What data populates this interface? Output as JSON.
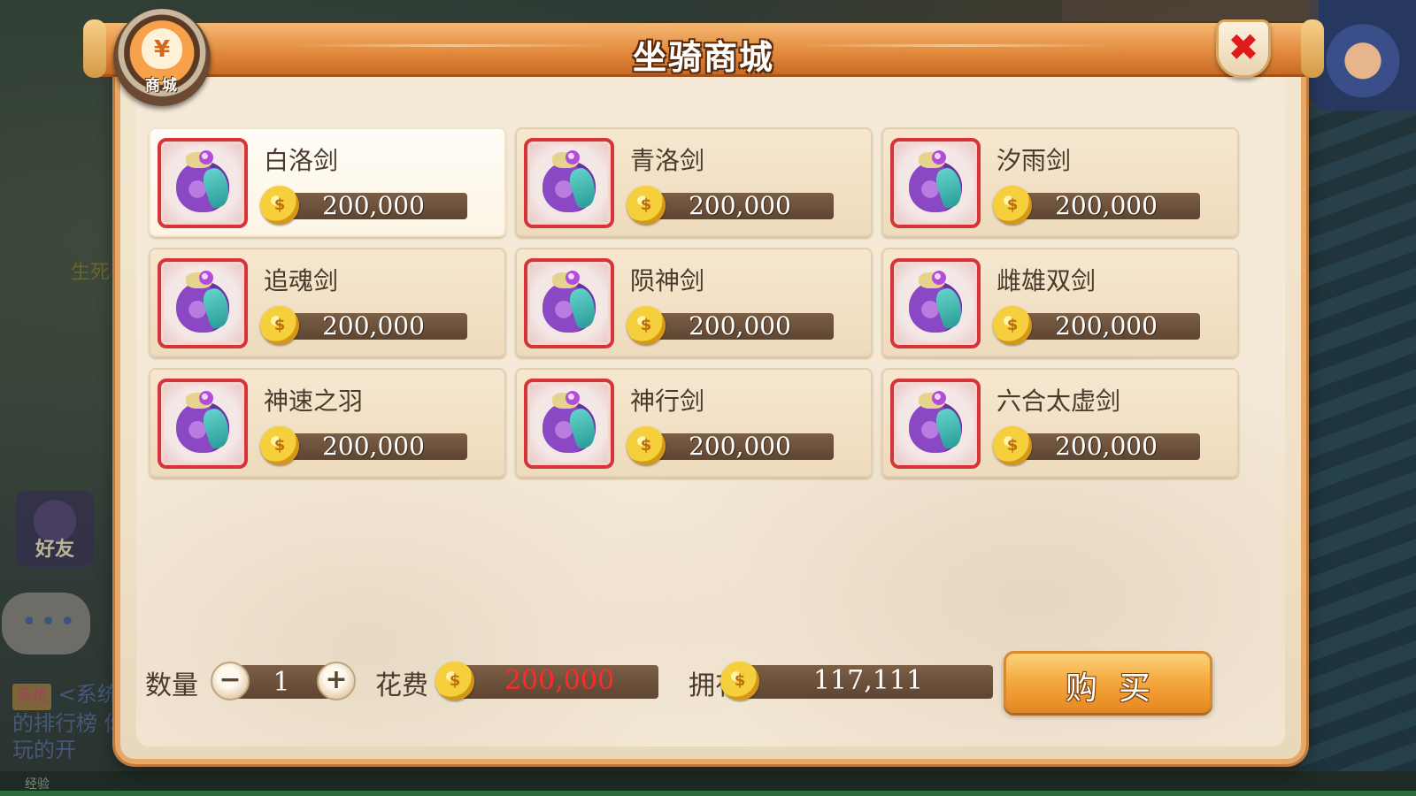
{
  "background": {
    "friend_label": "好友",
    "side_text": "生死",
    "system_badge": "系统",
    "system_message": "<系统 的排行榜 你玩的开",
    "exp_label": "经验"
  },
  "shop": {
    "badge_label": "商城",
    "badge_symbol": "¥",
    "title": "坐骑商城",
    "close_symbol": "✖"
  },
  "items": [
    {
      "name": "白洛剑",
      "price": "200,000",
      "selected": true
    },
    {
      "name": "青洛剑",
      "price": "200,000",
      "selected": false
    },
    {
      "name": "汐雨剑",
      "price": "200,000",
      "selected": false
    },
    {
      "name": "追魂剑",
      "price": "200,000",
      "selected": false
    },
    {
      "name": "陨神剑",
      "price": "200,000",
      "selected": false
    },
    {
      "name": "雌雄双剑",
      "price": "200,000",
      "selected": false
    },
    {
      "name": "神速之羽",
      "price": "200,000",
      "selected": false
    },
    {
      "name": "神行剑",
      "price": "200,000",
      "selected": false
    },
    {
      "name": "六合太虚剑",
      "price": "200,000",
      "selected": false
    }
  ],
  "purchase": {
    "quantity_label": "数量",
    "quantity_value": "1",
    "minus_symbol": "−",
    "plus_symbol": "+",
    "cost_label": "花费",
    "cost_value": "200,000",
    "owned_label": "拥有",
    "owned_value": "117,111",
    "buy_label": "购买"
  },
  "colors": {
    "accent": "#e38c3f",
    "cost_text": "#ff2a2a",
    "close_x": "#e0191b",
    "item_frame": "#d7343a"
  },
  "icons": {
    "currency": "gold-coin-icon",
    "item": "purple-pouch-icon",
    "close": "close-icon",
    "shop": "shop-bag-icon"
  }
}
